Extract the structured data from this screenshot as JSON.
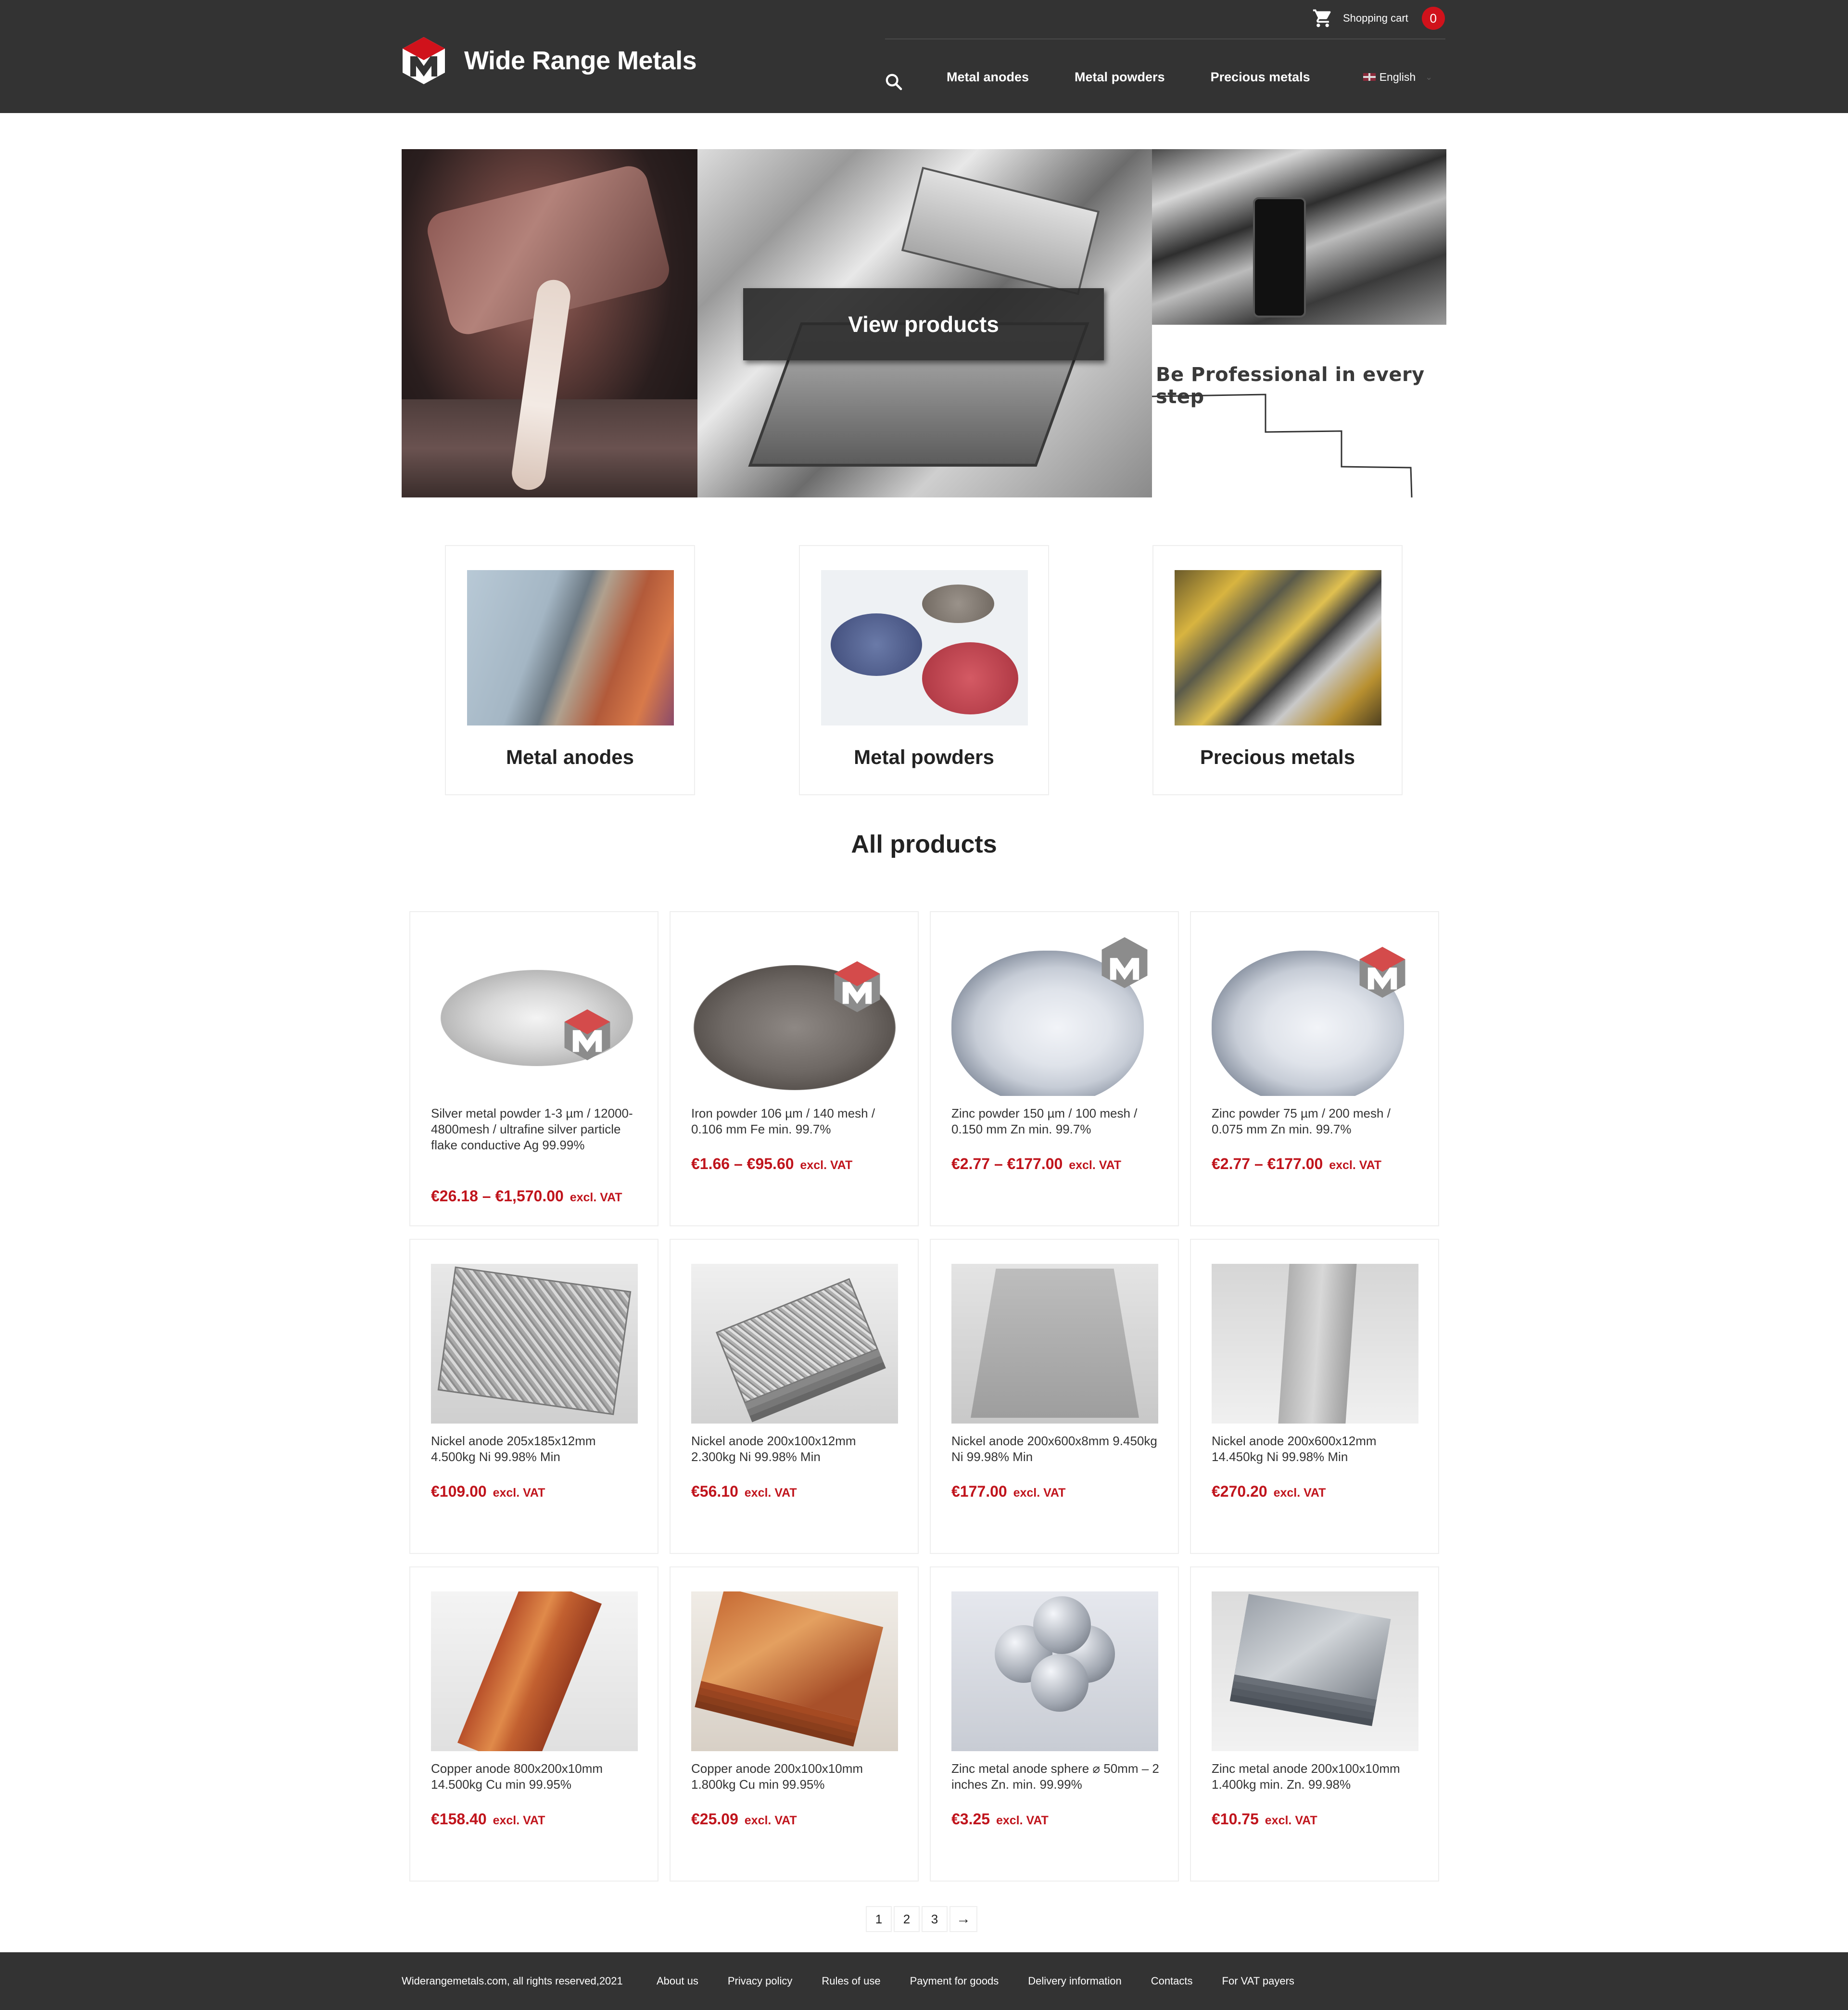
{
  "header": {
    "brand": "Wide Range Metals",
    "cart_label": "Shopping cart",
    "cart_count": "0",
    "nav": [
      "Metal anodes",
      "Metal powders",
      "Precious metals"
    ],
    "language": "English"
  },
  "hero": {
    "cta": "View products",
    "tagline": "Be Professional in every step"
  },
  "categories": [
    "Metal anodes",
    "Metal powders",
    "Precious metals"
  ],
  "all_products_title": "All products",
  "products": [
    {
      "name": "Silver metal powder 1-3 µm / 12000-4800mesh / ultrafine silver particle flake conductive Ag 99.99%",
      "price": "€26.18 – €1,570.00",
      "vat": "excl. VAT"
    },
    {
      "name": "Iron powder 106 µm / 140 mesh / 0.106 mm Fe min. 99.7%",
      "price": "€1.66 – €95.60",
      "vat": "excl. VAT"
    },
    {
      "name": "Zinc powder 150 µm / 100 mesh / 0.150 mm Zn min. 99.7%",
      "price": "€2.77 – €177.00",
      "vat": "excl. VAT"
    },
    {
      "name": "Zinc powder 75 µm / 200 mesh / 0.075 mm Zn min. 99.7%",
      "price": "€2.77 – €177.00",
      "vat": "excl. VAT"
    },
    {
      "name": "Nickel anode 205x185x12mm 4.500kg Ni 99.98% Min",
      "price": "€109.00",
      "vat": "excl. VAT"
    },
    {
      "name": "Nickel anode 200x100x12mm 2.300kg Ni 99.98% Min",
      "price": "€56.10",
      "vat": "excl. VAT"
    },
    {
      "name": "Nickel anode 200x600x8mm 9.450kg Ni 99.98% Min",
      "price": "€177.00",
      "vat": "excl. VAT"
    },
    {
      "name": "Nickel anode 200x600x12mm 14.450kg Ni 99.98% Min",
      "price": "€270.20",
      "vat": "excl. VAT"
    },
    {
      "name": "Copper anode 800x200x10mm 14.500kg Cu min 99.95%",
      "price": "€158.40",
      "vat": "excl. VAT"
    },
    {
      "name": "Copper anode 200x100x10mm 1.800kg Cu min 99.95%",
      "price": "€25.09",
      "vat": "excl. VAT"
    },
    {
      "name": "Zinc metal anode sphere ⌀ 50mm – 2 inches Zn. min. 99.99%",
      "price": "€3.25",
      "vat": "excl. VAT"
    },
    {
      "name": "Zinc metal anode 200x100x10mm 1.400kg min. Zn. 99.98%",
      "price": "€10.75",
      "vat": "excl. VAT"
    }
  ],
  "pagination": {
    "pages": [
      "1",
      "2",
      "3"
    ],
    "next": "→"
  },
  "footer": {
    "copyright": "Widerangemetals.com, all rights reserved,2021",
    "links": [
      "About us",
      "Privacy policy",
      "Rules of use",
      "Payment for goods",
      "Delivery information",
      "Contacts",
      "For VAT payers"
    ]
  },
  "colors": {
    "header_bg": "#333333",
    "accent_red": "#c0141c",
    "badge_red": "#d0121b"
  }
}
